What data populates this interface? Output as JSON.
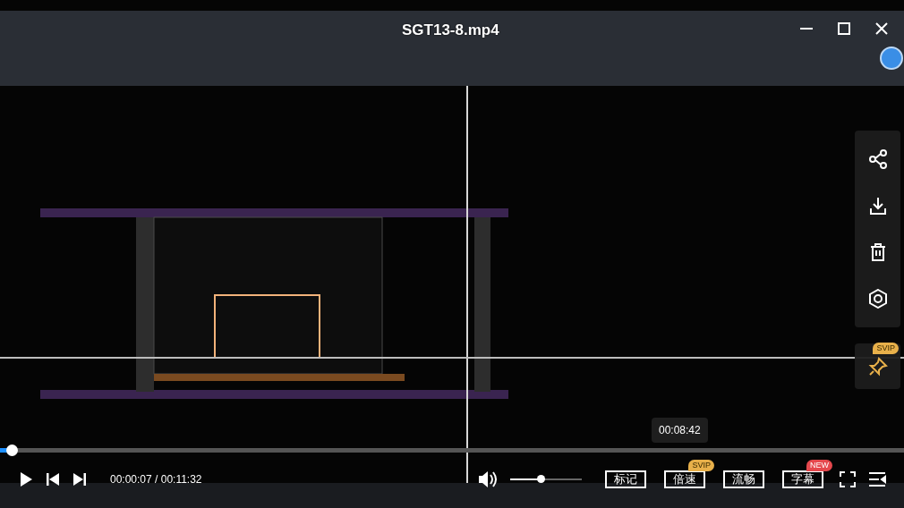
{
  "title": "SGT13-8.mp4",
  "pin": {
    "badge": {
      "text": "SVIP",
      "color": "#e8b04a"
    }
  },
  "progress": {
    "level": 0.013,
    "hover_time": "00:08:42"
  },
  "time": "00:00:07 / 00:11:32",
  "volume": {
    "level": 0.42
  },
  "buttons": [
    {
      "label": "标记"
    },
    {
      "label": "倍速",
      "badge": {
        "text": "SVIP",
        "color": "#e8b04a"
      }
    },
    {
      "label": "流畅"
    },
    {
      "label": "字幕",
      "badge": {
        "text": "NEW",
        "color": "#e5484d"
      }
    }
  ]
}
